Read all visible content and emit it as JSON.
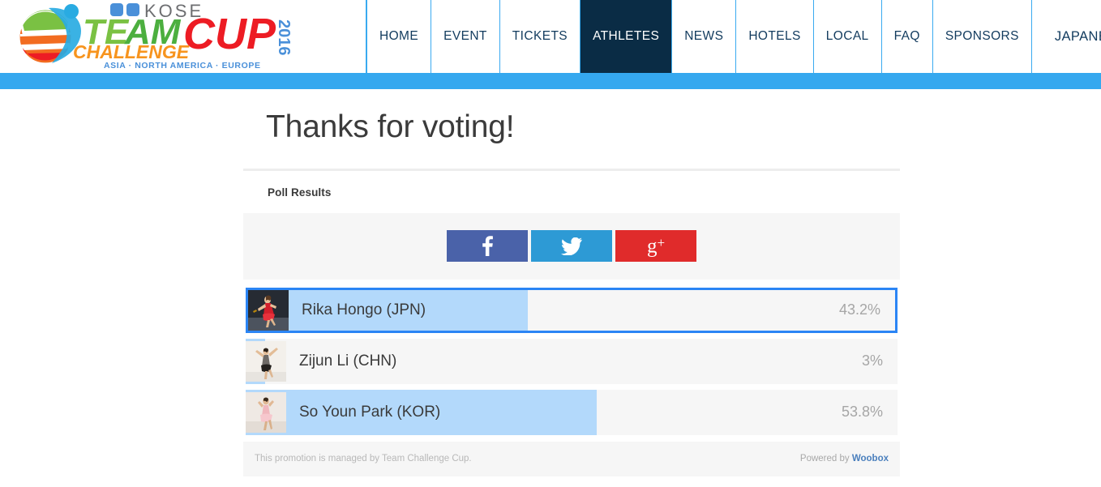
{
  "site": {
    "logo": {
      "brand_top": "KOSE",
      "word_team": "TEAM",
      "word_challenge": "CHALLENGE",
      "word_cup": "CUP",
      "year": "2016",
      "tagline": "ASIA · NORTH AMERICA · EUROPE"
    },
    "nav": {
      "items": [
        {
          "label": "HOME",
          "active": false
        },
        {
          "label": "EVENT",
          "active": false
        },
        {
          "label": "TICKETS",
          "active": false
        },
        {
          "label": "ATHLETES",
          "active": true
        },
        {
          "label": "NEWS",
          "active": false
        },
        {
          "label": "HOTELS",
          "active": false
        },
        {
          "label": "LOCAL",
          "active": false
        },
        {
          "label": "FAQ",
          "active": false
        },
        {
          "label": "SPONSORS",
          "active": false
        }
      ],
      "language_item": "JAPANESE LANGUAGE"
    },
    "accent_band_color": "#35a8ef"
  },
  "main": {
    "title": "Thanks for voting!",
    "poll_heading": "Poll Results",
    "share": {
      "facebook_label": "f",
      "twitter_label": "twitter-bird",
      "googleplus_label": "g+"
    },
    "options": [
      {
        "name": "Rika Hongo (JPN)",
        "percent_label": "43.2%",
        "percent_value": 43.2,
        "selected": true,
        "thumb_alt": "rika-hongo-photo"
      },
      {
        "name": "Zijun Li (CHN)",
        "percent_label": "3%",
        "percent_value": 3,
        "selected": false,
        "thumb_alt": "zijun-li-photo"
      },
      {
        "name": "So Youn Park (KOR)",
        "percent_label": "53.8%",
        "percent_value": 53.8,
        "selected": false,
        "thumb_alt": "so-youn-park-photo"
      }
    ],
    "footer": {
      "managed_by": "This promotion is managed by Team Challenge Cup.",
      "powered_prefix": "Powered by ",
      "powered_brand": "Woobox"
    }
  },
  "colors": {
    "nav_active_bg": "#0a2c45",
    "nav_text": "#123b5e",
    "band": "#35a8ef",
    "bar_fill": "#b3d9fb",
    "bar_track": "#f6f6f6",
    "selected_border": "#2b85f5",
    "facebook": "#4a62a9",
    "twitter": "#2d9ad5",
    "googleplus": "#e02b2b",
    "link": "#4a7fbd"
  }
}
